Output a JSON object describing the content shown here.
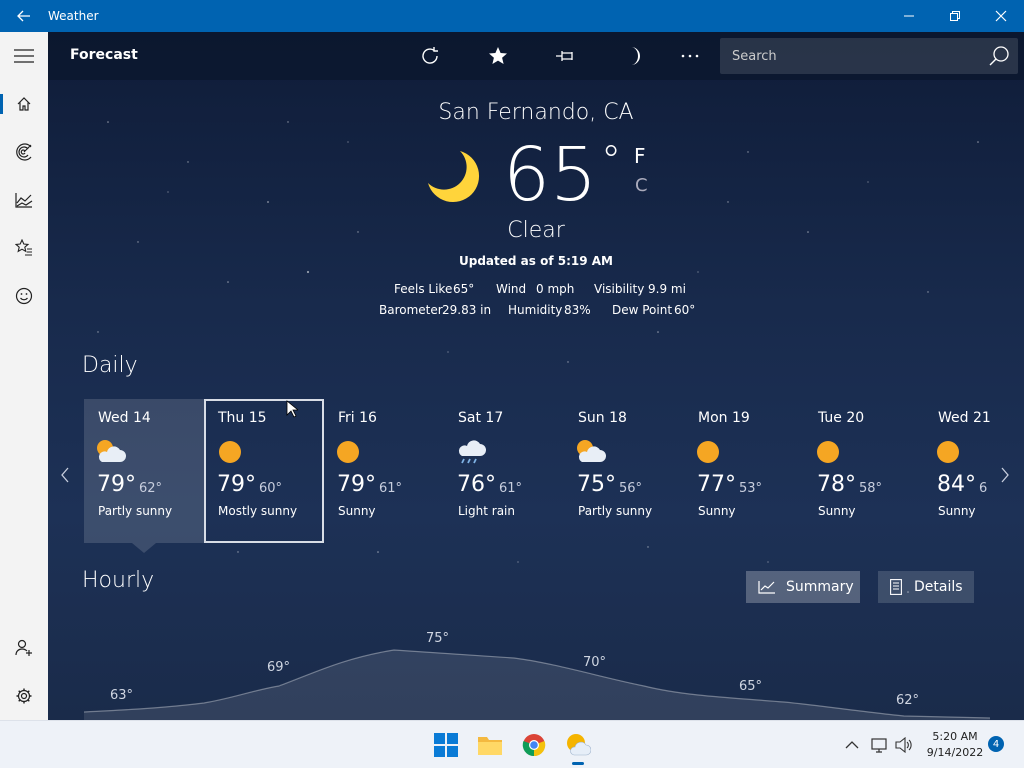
{
  "window": {
    "title": "Weather"
  },
  "header": {
    "page_title": "Forecast",
    "search_placeholder": "Search"
  },
  "current": {
    "location": "San Fernando, CA",
    "temperature": "65",
    "degree": "°",
    "unit_f": "F",
    "unit_c": "C",
    "condition": "Clear",
    "updated": "Updated as of 5:19 AM",
    "details": {
      "feels_like_label": "Feels Like",
      "feels_like_value": "65°",
      "wind_label": "Wind",
      "wind_value": "0 mph",
      "visibility_label": "Visibility",
      "visibility_value": "9.9 mi",
      "barometer_label": "Barometer",
      "barometer_value": "29.83 in",
      "humidity_label": "Humidity",
      "humidity_value": "83%",
      "dew_point_label": "Dew Point",
      "dew_point_value": "60°"
    }
  },
  "daily": {
    "title": "Daily",
    "days": [
      {
        "name": "Wed 14",
        "hi": "79°",
        "lo": "62°",
        "condition": "Partly sunny",
        "icon": "partly-sunny-icon"
      },
      {
        "name": "Thu 15",
        "hi": "79°",
        "lo": "60°",
        "condition": "Mostly sunny",
        "icon": "sun-icon"
      },
      {
        "name": "Fri 16",
        "hi": "79°",
        "lo": "61°",
        "condition": "Sunny",
        "icon": "sun-icon"
      },
      {
        "name": "Sat 17",
        "hi": "76°",
        "lo": "61°",
        "condition": "Light rain",
        "icon": "light-rain-icon"
      },
      {
        "name": "Sun 18",
        "hi": "75°",
        "lo": "56°",
        "condition": "Partly sunny",
        "icon": "partly-sunny-icon"
      },
      {
        "name": "Mon 19",
        "hi": "77°",
        "lo": "53°",
        "condition": "Sunny",
        "icon": "sun-icon"
      },
      {
        "name": "Tue 20",
        "hi": "78°",
        "lo": "58°",
        "condition": "Sunny",
        "icon": "sun-icon"
      },
      {
        "name": "Wed 21",
        "hi": "84°",
        "lo": "6",
        "condition": "Sunny",
        "icon": "sun-icon"
      }
    ]
  },
  "hourly": {
    "title": "Hourly",
    "summary_label": "Summary",
    "details_label": "Details",
    "labels": [
      "63°",
      "69°",
      "75°",
      "70°",
      "65°",
      "62°"
    ]
  },
  "taskbar": {
    "time": "5:20 AM",
    "date": "9/14/2022",
    "notification_count": "4"
  },
  "colors": {
    "titlebar": "#0063b1",
    "sun": "#f5a623",
    "moon": "#ffd43b"
  }
}
